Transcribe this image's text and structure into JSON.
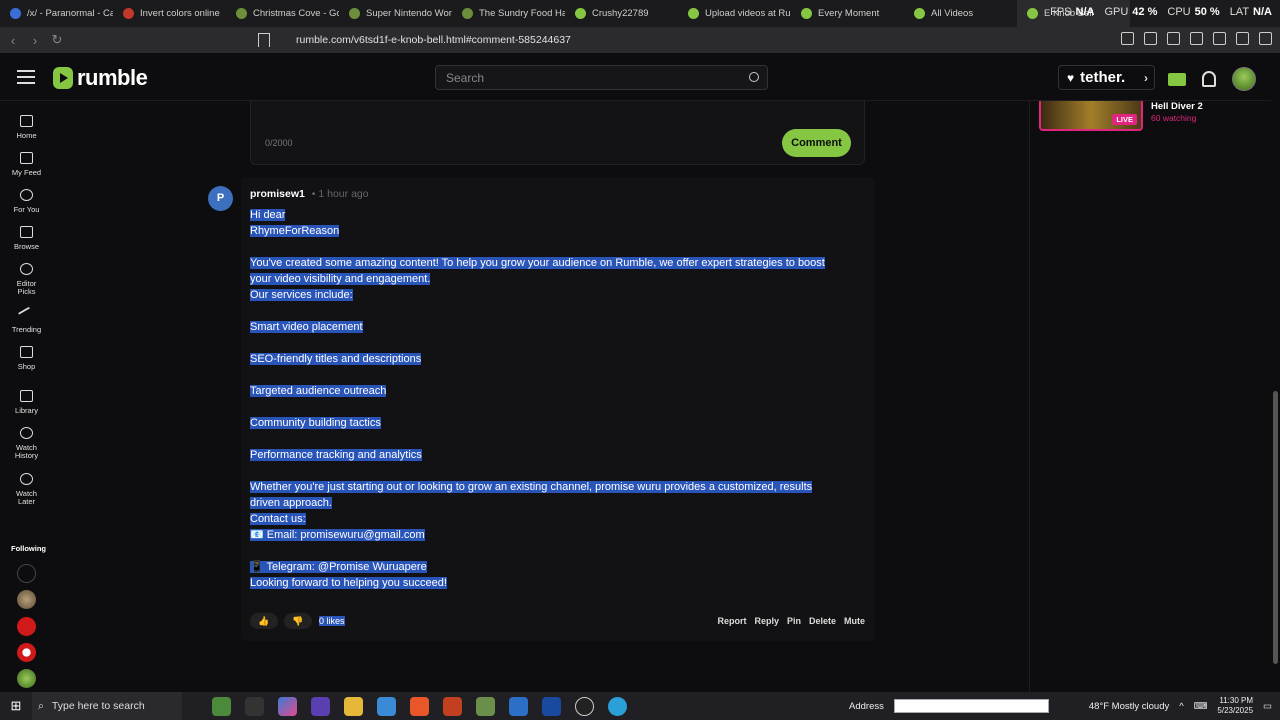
{
  "browser": {
    "tabs": [
      {
        "title": "/x/ - Paranormal - Cat",
        "icon_color": "#3a6fd8"
      },
      {
        "title": "Invert colors online",
        "icon_color": "#c0392b"
      },
      {
        "title": "Christmas Cove - Goo",
        "icon_color": "#6b8f3a"
      },
      {
        "title": "Super Nintendo World",
        "icon_color": "#6b8f3a"
      },
      {
        "title": "The Sundry Food Hall",
        "icon_color": "#6b8f3a"
      },
      {
        "title": "Crushy22789",
        "icon_color": "#85c742"
      },
      {
        "title": "Upload videos at Rum",
        "icon_color": "#85c742"
      },
      {
        "title": "Every Moment",
        "icon_color": "#85c742"
      },
      {
        "title": "All Videos",
        "icon_color": "#85c742"
      },
      {
        "title": "E Knob Bell",
        "icon_color": "#85c742"
      }
    ],
    "url": "rumble.com/v6tsd1f-e-knob-bell.html#comment-585244637",
    "perf": {
      "fps_label": "FPS",
      "fps": "N/A",
      "gpu_label": "GPU",
      "gpu": "42 %",
      "cpu_label": "CPU",
      "cpu": "50 %",
      "lat_label": "LAT",
      "lat": "N/A"
    }
  },
  "header": {
    "logo": "rumble",
    "search_placeholder": "Search",
    "sponsor": "tether."
  },
  "sidebar": {
    "items": [
      {
        "label": "Home"
      },
      {
        "label": "My Feed"
      },
      {
        "label": "For You"
      },
      {
        "label": "Browse"
      },
      {
        "label": "Editor Picks"
      },
      {
        "label": "Trending"
      },
      {
        "label": "Shop"
      },
      {
        "label": "Library"
      },
      {
        "label": "Watch History"
      },
      {
        "label": "Watch Later"
      }
    ],
    "following_label": "Following"
  },
  "reply_box": {
    "counter": "0/2000",
    "submit_label": "Comment"
  },
  "comment": {
    "avatar_letter": "P",
    "username": "promisew1",
    "time": "• 1 hour ago",
    "lines": [
      "Hi dear",
      "RhymeForReason",
      "",
      "You've created some amazing content! To help you grow your audience on Rumble, we offer expert strategies to boost",
      "your video visibility and engagement.",
      "Our services include:",
      "",
      "Smart video placement",
      "",
      "SEO-friendly titles and descriptions",
      "",
      "Targeted audience outreach",
      "",
      "Community building tactics",
      "",
      "Performance tracking and analytics",
      "",
      "Whether you're just starting out or looking to grow an existing channel, promise wuru provides a customized, results",
      "driven approach.",
      "Contact us:",
      "📧 Email: promisewuru@gmail.com",
      "",
      "📱 Telegram: @Promise Wuruapere",
      "Looking forward to helping you succeed!"
    ],
    "likes": "0 likes",
    "actions": [
      "Report",
      "Reply",
      "Pin",
      "Delete",
      "Mute"
    ]
  },
  "live": {
    "badge": "LIVE",
    "title": "Hell Diver 2",
    "watching": "60 watching"
  },
  "taskbar": {
    "search_placeholder": "Type here to search",
    "address_label": "Address",
    "weather": "48°F  Mostly cloudy",
    "time": "11:30 PM",
    "date": "5/23/2025"
  }
}
